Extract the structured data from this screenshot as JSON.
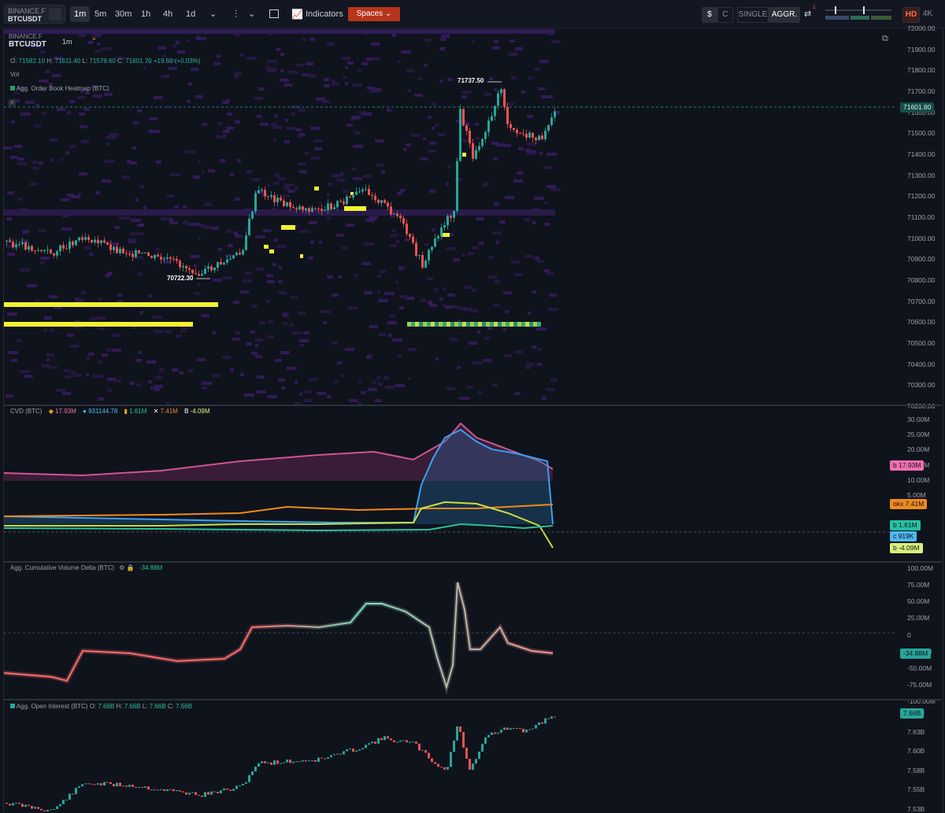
{
  "toolbar": {
    "exchange": "BINANCE.F",
    "symbol": "BTCUSDT",
    "timeframes": [
      "1m",
      "5m",
      "30m",
      "1h",
      "4h",
      "1d"
    ],
    "indicators_label": "Indicators",
    "spaces_label": "Spaces",
    "currency": "$",
    "coin": "C",
    "single": "SINGLE",
    "aggr": "AGGR.",
    "notif_count": "1",
    "hd": "HD",
    "k4": "4K"
  },
  "chart": {
    "exchange": "BINANCE.F",
    "symbol": "BTCUSDT",
    "interval": "1m",
    "ohlc": {
      "o": "71582.10",
      "h": "71611.40",
      "l": "71578.60",
      "c": "71601.70",
      "chg": "+19.60",
      "pct": "(+0.03%)"
    },
    "vol_label": "Vol",
    "heatmap_label": "Agg. Order Book Heatmap (BTC)",
    "high_marker": "71737.50",
    "low_marker": "70722.30",
    "last_price": "71601.80",
    "price_axis": [
      "72000.00",
      "71900.00",
      "71800.00",
      "71700.00",
      "71600.00",
      "71500.00",
      "71400.00",
      "71300.00",
      "71200.00",
      "71100.00",
      "71000.00",
      "70900.00",
      "70800.00",
      "70700.00",
      "70600.00",
      "70500.00",
      "70400.00",
      "70300.00",
      "70200.00"
    ]
  },
  "cvd": {
    "label": "CVD (BTC)",
    "values": [
      "17.93M",
      "931144.78",
      "1.61M",
      "7.41M",
      "-4.09M"
    ],
    "axis": [
      "30.00M",
      "25.00M",
      "20.00M",
      "15.00M",
      "10.00M",
      "5.00M"
    ],
    "tags": [
      {
        "ex": "b",
        "v": "17.93M",
        "color": "#f06fb0"
      },
      {
        "ex": "okx",
        "v": "7.41M",
        "color": "#f08a1c"
      },
      {
        "ex": "b",
        "v": "1.61M",
        "color": "#26c2a0"
      },
      {
        "ex": "c",
        "v": "919K",
        "color": "#4fb8f0"
      },
      {
        "ex": "b",
        "v": "-4.09M",
        "color": "#d9f27a"
      }
    ]
  },
  "aggcvd": {
    "label": "Agg. Cumulative Volume Delta (BTC)",
    "value": "-34.88M",
    "axis": [
      "100.00M",
      "75.00M",
      "50.00M",
      "25.00M",
      "0",
      "-25.00M",
      "-50.00M",
      "-75.00M",
      "-100.00M"
    ]
  },
  "oi": {
    "label": "Agg. Open Interest (BTC)",
    "ohlc": {
      "o": "7.66B",
      "h": "7.66B",
      "l": "7.66B",
      "c": "7.66B"
    },
    "last": "7.66B",
    "axis": [
      "7.65B",
      "7.63B",
      "7.60B",
      "7.58B",
      "7.55B",
      "7.53B"
    ]
  }
}
